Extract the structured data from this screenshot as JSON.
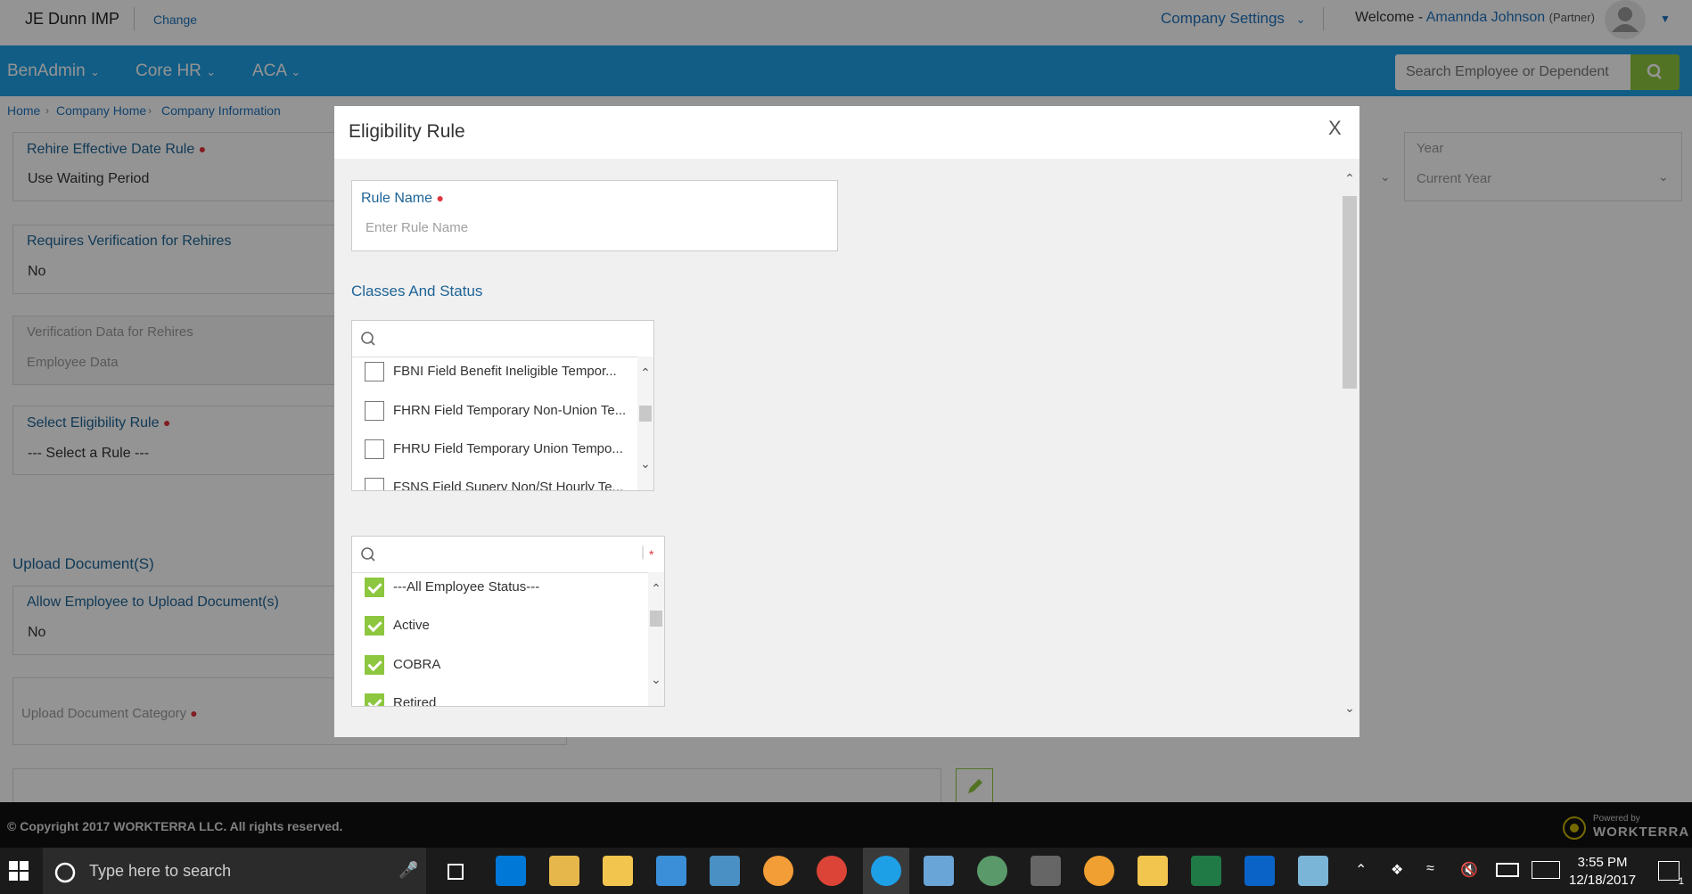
{
  "header": {
    "brand": "JE Dunn IMP",
    "change": "Change",
    "company_settings": "Company Settings",
    "welcome": "Welcome -",
    "user_name": "Amannda Johnson",
    "user_role": "(Partner)"
  },
  "nav": {
    "items": [
      {
        "label": "BenAdmin"
      },
      {
        "label": "Core HR"
      },
      {
        "label": "ACA"
      }
    ],
    "search_placeholder": "Search Employee or Dependent"
  },
  "breadcrumb": [
    "Home",
    "Company Home",
    "Company Information"
  ],
  "background": {
    "rehire_label": "Rehire Effective Date Rule",
    "rehire_value": "Use Waiting Period",
    "verif_label": "Requires Verification for Rehires",
    "verif_value": "No",
    "verif_data_label": "Verification Data for Rehires",
    "verif_data_value": "Employee Data",
    "select_rule_label": "Select Eligibility Rule",
    "select_rule_value": "--- Select a Rule ---",
    "upload_section": "Upload Document(S)",
    "allow_upload_label": "Allow Employee to Upload Document(s)",
    "allow_upload_value": "No",
    "upload_category_label": "Upload Document Category",
    "year_label": "Year",
    "year_value": "Current Year"
  },
  "footer": {
    "copyright": "© Copyright 2017 WORKTERRA LLC. All rights reserved.",
    "powered_by": "Powered by",
    "logo_text": "WORKTERRA"
  },
  "modal": {
    "title": "Eligibility Rule",
    "close": "X",
    "rule_name_label": "Rule Name",
    "rule_name_placeholder": "Enter Rule Name",
    "section_title": "Classes And Status",
    "classes": [
      {
        "label": "FBNI Field Benefit Ineligible Tempor...",
        "checked": false
      },
      {
        "label": "FHRN Field Temporary Non-Union Te...",
        "checked": false
      },
      {
        "label": "FHRU Field Temporary Union Tempo...",
        "checked": false
      },
      {
        "label": "FSNS Field Superv Non/St Hourly Te...",
        "checked": false
      }
    ],
    "statuses": [
      {
        "label": "---All Employee Status---",
        "checked": true
      },
      {
        "label": "Active",
        "checked": true
      },
      {
        "label": "COBRA",
        "checked": true
      },
      {
        "label": "Retired",
        "checked": true
      }
    ]
  },
  "taskbar": {
    "search_placeholder": "Type here to search",
    "time": "3:55 PM",
    "date": "12/18/2017",
    "notifications": "1"
  }
}
